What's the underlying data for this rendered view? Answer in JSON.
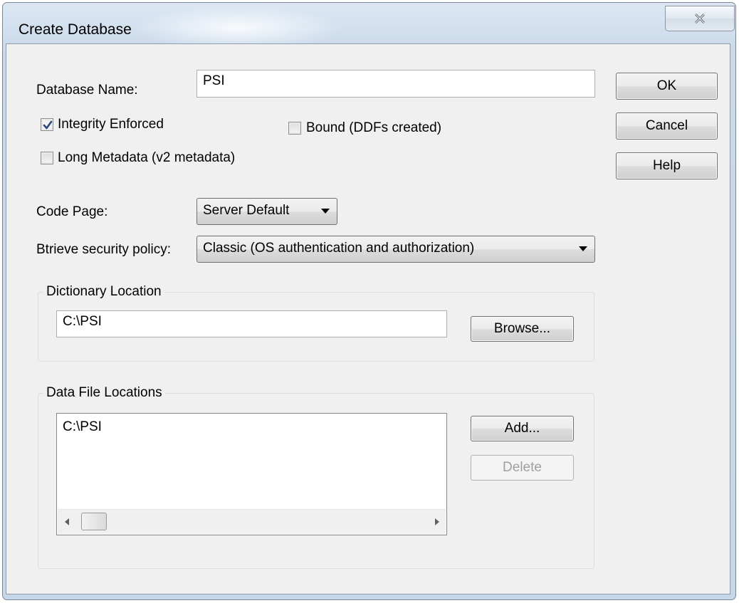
{
  "window": {
    "title": "Create Database"
  },
  "form": {
    "db_name_label": "Database Name:",
    "db_name_value": "PSI",
    "integrity_label": "Integrity Enforced",
    "integrity_checked": true,
    "bound_label": "Bound (DDFs created)",
    "bound_checked": false,
    "long_meta_label": "Long Metadata (v2 metadata)",
    "long_meta_checked": false,
    "code_page_label": "Code Page:",
    "code_page_value": "Server Default",
    "security_label": "Btrieve security policy:",
    "security_value": "Classic (OS authentication and authorization)"
  },
  "dictionary": {
    "group_label": "Dictionary Location",
    "path": "C:\\PSI",
    "browse_label": "Browse..."
  },
  "data_files": {
    "group_label": "Data File Locations",
    "items": [
      "C:\\PSI"
    ],
    "add_label": "Add...",
    "delete_label": "Delete"
  },
  "buttons": {
    "ok": "OK",
    "cancel": "Cancel",
    "help": "Help"
  },
  "icons": {
    "close": "close-icon",
    "check": "checkmark-icon",
    "dropdown": "chevron-down-icon",
    "scroll_left": "arrow-left-icon",
    "scroll_right": "arrow-right-icon"
  },
  "colors": {
    "window_frame": "#c9d9ea",
    "client": "#f0f0f0",
    "checkmark": "#2c4a7a"
  }
}
